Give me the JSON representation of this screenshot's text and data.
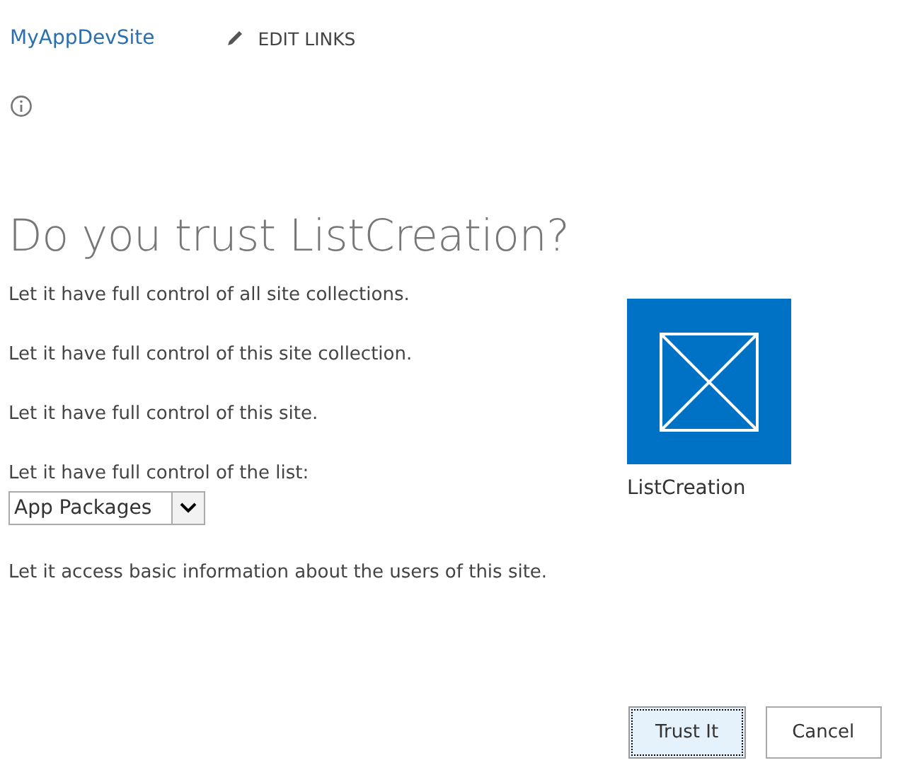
{
  "header": {
    "site_title": "MyAppDevSite",
    "edit_links": "EDIT LINKS"
  },
  "heading": "Do you trust ListCreation?",
  "permissions": [
    {
      "kind": "text",
      "label": "Let it have full control of all site collections."
    },
    {
      "kind": "text",
      "label": "Let it have full control of this site collection."
    },
    {
      "kind": "text",
      "label": "Let it have full control of this site."
    },
    {
      "kind": "select",
      "label": "Let it have full control of the list:",
      "value": "App Packages"
    },
    {
      "kind": "text",
      "label": "Let it access basic information about the users of this site."
    }
  ],
  "app": {
    "name": "ListCreation"
  },
  "buttons": [
    {
      "label": "Trust It",
      "focused": true
    },
    {
      "label": "Cancel",
      "focused": false
    }
  ]
}
